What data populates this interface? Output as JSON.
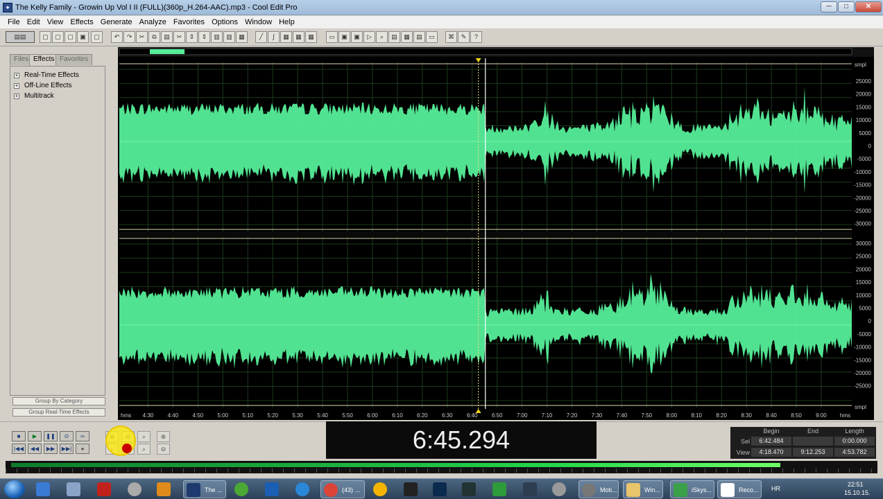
{
  "window": {
    "title": "The Kelly Family - Growin Up Vol I II (FULL)(360p_H.264-AAC).mp3 - Cool Edit Pro",
    "controls": [
      "─",
      "□",
      "✕"
    ]
  },
  "menu": [
    "File",
    "Edit",
    "View",
    "Effects",
    "Generate",
    "Analyze",
    "Favorites",
    "Options",
    "Window",
    "Help"
  ],
  "left_panel": {
    "tabs": [
      "Files",
      "Effects",
      "Favorites"
    ],
    "tree": [
      "Real-Time Effects",
      "Off-Line Effects",
      "Multitrack"
    ],
    "buttons": [
      "Group By Category",
      "Group Real-Time Effects"
    ]
  },
  "waveform": {
    "amp_unit": "smpl",
    "amp_ticks": [
      "25000",
      "20000",
      "15000",
      "10000",
      "5000",
      "0",
      "-5000",
      "-10000",
      "-15000",
      "-20000",
      "-25000",
      "-30000"
    ],
    "amp_ticks_right": [
      "30000",
      "25000",
      "20000",
      "15000",
      "10000",
      "5000",
      "0",
      "-5000",
      "-10000",
      "-15000",
      "-20000",
      "-25000"
    ],
    "time_unit": "hms",
    "time_ticks": [
      "4:30",
      "4:40",
      "4:50",
      "5:00",
      "5:10",
      "5:20",
      "5:30",
      "5:40",
      "5:50",
      "6:00",
      "6:10",
      "6:20",
      "6:30",
      "6:40",
      "6:50",
      "7:00",
      "7:10",
      "7:20",
      "7:30",
      "7:40",
      "7:50",
      "8:00",
      "8:10",
      "8:20",
      "8:30",
      "8:40",
      "8:50",
      "9:00"
    ],
    "view_begin_seconds": 258.47,
    "view_end_seconds": 552.253,
    "playhead_seconds": 405.294,
    "wave_color": "#55ee99"
  },
  "transport": {
    "row1": [
      "■",
      "▶",
      "❚❚",
      "⊙",
      "∞"
    ],
    "row2": [
      "|◀◀",
      "◀◀",
      "▶▶",
      "▶▶|",
      "●"
    ]
  },
  "time_display": "6:45.294",
  "selection": {
    "headers": [
      "Begin",
      "End",
      "Length"
    ],
    "sel_label": "Sel",
    "view_label": "View",
    "sel": [
      "6:42.484",
      "",
      "0:00.000"
    ],
    "view": [
      "4:18.470",
      "9:12.253",
      "4:53.782"
    ]
  },
  "level_meter_fraction": 0.9,
  "taskbar": {
    "items": [
      "The ...",
      "",
      "",
      "",
      "(43) ...",
      "",
      "",
      "",
      "",
      "",
      "",
      "",
      "Moti...",
      "Win...",
      "iSkys...",
      "Reco..."
    ],
    "lang": "HR",
    "time": "22:51",
    "date": "15.10.15."
  }
}
